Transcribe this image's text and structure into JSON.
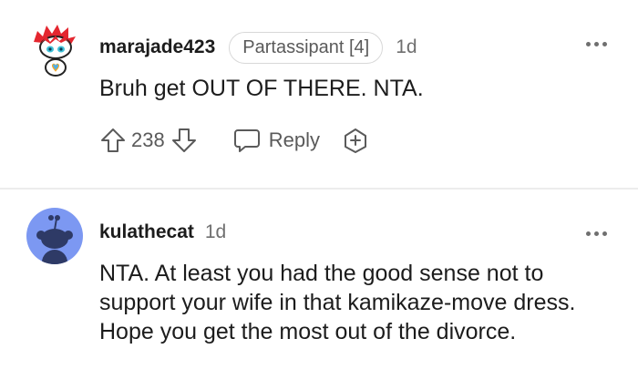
{
  "comments": [
    {
      "username": "marajade423",
      "flair": "Partassipant [4]",
      "age": "1d",
      "text": "Bruh get OUT OF THERE. NTA.",
      "votes": "238",
      "reply_label": "Reply",
      "icons": [
        "snoo-avatar-red-hair",
        "upvote-icon",
        "downvote-icon",
        "reply-bubble-icon",
        "award-icon",
        "more-options-icon"
      ]
    },
    {
      "username": "kulathecat",
      "age": "1d",
      "text": "NTA. At least you had the good sense not to support your wife in that kamikaze-move dress. Hope you get the most out of the divorce.",
      "icons": [
        "default-snoo-avatar",
        "more-options-icon"
      ]
    }
  ],
  "colors": {
    "text": "#1c1c1c",
    "muted": "#6f6f6f",
    "avatar_bg": "#7c98f2",
    "divider": "#ececec"
  }
}
